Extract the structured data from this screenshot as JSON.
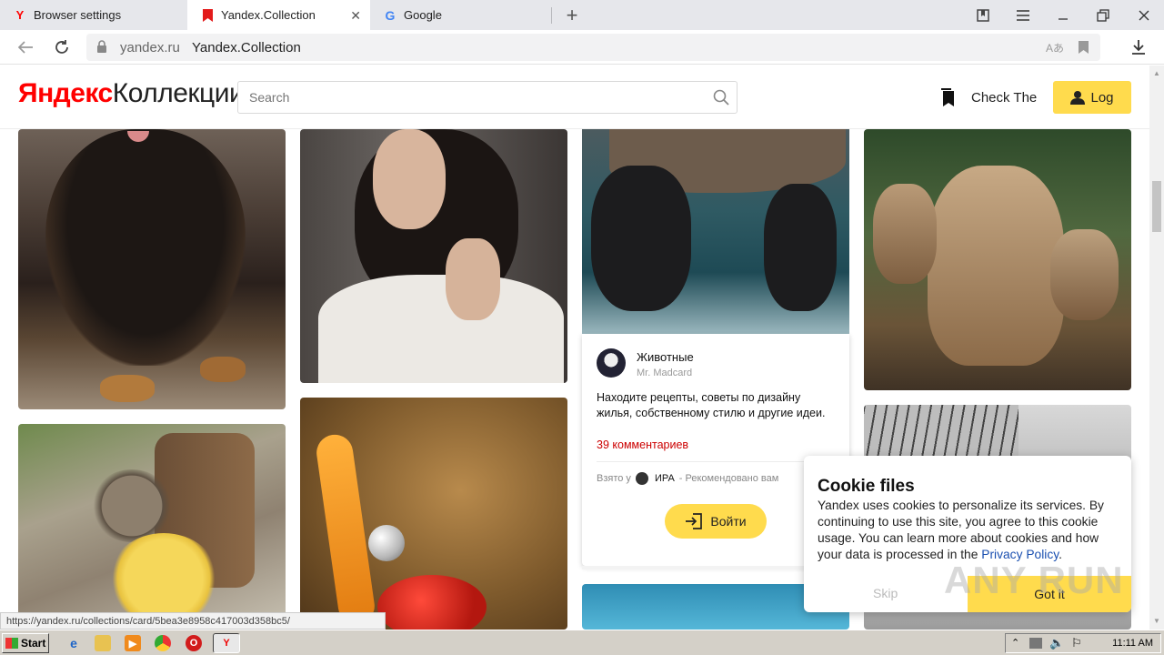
{
  "tabs": [
    {
      "title": "Browser settings",
      "favicon": "yandex-y-icon",
      "active": false
    },
    {
      "title": "Yandex.Collection",
      "favicon": "bookmark-red-icon",
      "active": true
    },
    {
      "title": "Google",
      "favicon": "google-g-icon",
      "active": false
    }
  ],
  "address": {
    "domain": "yandex.ru",
    "page_title": "Yandex.Collection"
  },
  "header": {
    "logo_yandex": "Яндекс",
    "logo_collections": "Коллекции",
    "search_placeholder": "Search",
    "check_label": "Check The",
    "login_label": "Log"
  },
  "info_card": {
    "title": "Животные",
    "user": "Mr. Madcard",
    "description": "Находите рецепты, советы по дизайну жилья, собственному стилю и другие идеи.",
    "comments": "39 комментариев",
    "taken_from": "Взято у",
    "taken_user": "ИРА",
    "recommended": "- Рекомендовано вам"
  },
  "login_big_label": "Войти",
  "cookie": {
    "title": "Cookie files",
    "text": "Yandex uses cookies to personalize its services. By continuing to use this site, you agree to this cookie usage. You can learn more about cookies and how your data is processed in the",
    "link": "Privacy Policy",
    "text_end": ".",
    "skip": "Skip",
    "got_it": "Got it"
  },
  "status_url": "https://yandex.ru/collections/card/5bea3e8958c417003d358bc5/",
  "watermark": "ANY RUN",
  "taskbar": {
    "start": "Start",
    "clock": "11:11 AM"
  },
  "colors": {
    "accent_yellow": "#ffdb4d",
    "yandex_red": "#ff0000",
    "link_blue": "#1a4fb0"
  }
}
